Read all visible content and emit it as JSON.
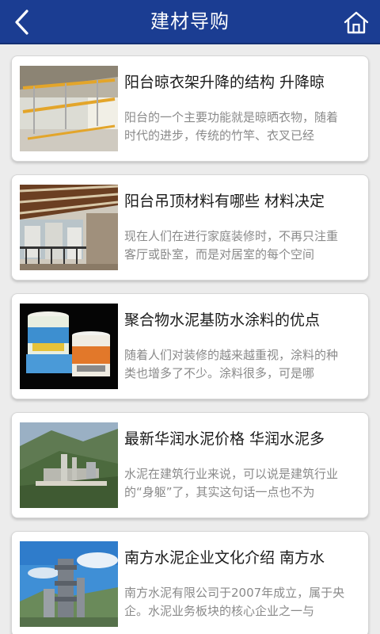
{
  "header": {
    "title": "建材导购",
    "back_icon": "chevron-left-icon",
    "home_icon": "home-icon",
    "background": "#1b3d92"
  },
  "articles": [
    {
      "title": "阳台晾衣架升降的结构 升降晾",
      "desc": "阳台的一个主要功能就是晾晒衣物，随着时代的进步，传统的竹竿、衣叉已经",
      "image": "balcony-clothes-rack-photo"
    },
    {
      "title": "阳台吊顶材料有哪些 材料决定",
      "desc": "现在人们在进行家庭装修时，不再只注重客厅或卧室，而是对居室的每个空间",
      "image": "balcony-ceiling-photo"
    },
    {
      "title": "聚合物水泥基防水涂料的优点",
      "desc": "随着人们对装修的越来越重视，涂料的种类也增多了不少。涂料很多，可是哪",
      "image": "waterproof-paint-buckets-photo"
    },
    {
      "title": "最新华润水泥价格 华润水泥多",
      "desc": "水泥在建筑行业来说，可以说是建筑行业的“身躯”了，其实这句话一点也不为",
      "image": "cement-plant-landscape-photo"
    },
    {
      "title": "南方水泥企业文化介绍 南方水",
      "desc": "南方水泥有限公司于2007年成立，属于央企。水泥业务板块的核心企业之一与",
      "image": "cement-factory-tower-photo"
    }
  ]
}
